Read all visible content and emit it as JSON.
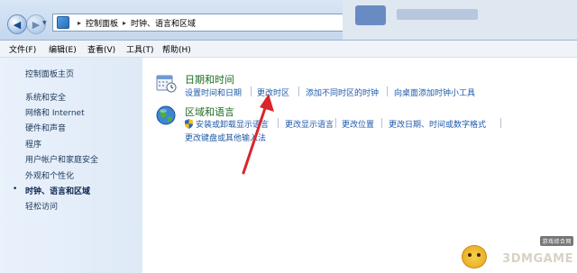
{
  "address": {
    "segments": [
      "控制面板",
      "时钟、语言和区域"
    ],
    "separator": "▸"
  },
  "menu": [
    "文件(F)",
    "编辑(E)",
    "查看(V)",
    "工具(T)",
    "帮助(H)"
  ],
  "sidebar": {
    "items": [
      {
        "label": "控制面板主页"
      },
      {
        "label": "系统和安全"
      },
      {
        "label": "网络和 Internet"
      },
      {
        "label": "硬件和声音"
      },
      {
        "label": "程序"
      },
      {
        "label": "用户帐户和家庭安全"
      },
      {
        "label": "外观和个性化"
      },
      {
        "label": "时钟、语言和区域",
        "active": true
      },
      {
        "label": "轻松访问"
      }
    ],
    "active_bullet": "•"
  },
  "categories": [
    {
      "title": "日期和时间",
      "icon": "calendar-clock-icon",
      "links": [
        "设置时间和日期",
        "更改时区",
        "添加不同时区的时钟",
        "向桌面添加时钟小工具"
      ]
    },
    {
      "title": "区域和语言",
      "icon": "globe-icon",
      "links": [
        "安装或卸载显示语言",
        "更改显示语言",
        "更改位置",
        "更改日期、时间或数字格式",
        "更改键盘或其他输入法"
      ]
    }
  ],
  "watermark": {
    "text": "3DMGAME",
    "tag": "游戏综合网"
  },
  "colors": {
    "link": "#1e5aa8",
    "category_title": "#1c6b21",
    "sidebar_bg": "#e2ecf8",
    "arrow": "#d9262b"
  }
}
